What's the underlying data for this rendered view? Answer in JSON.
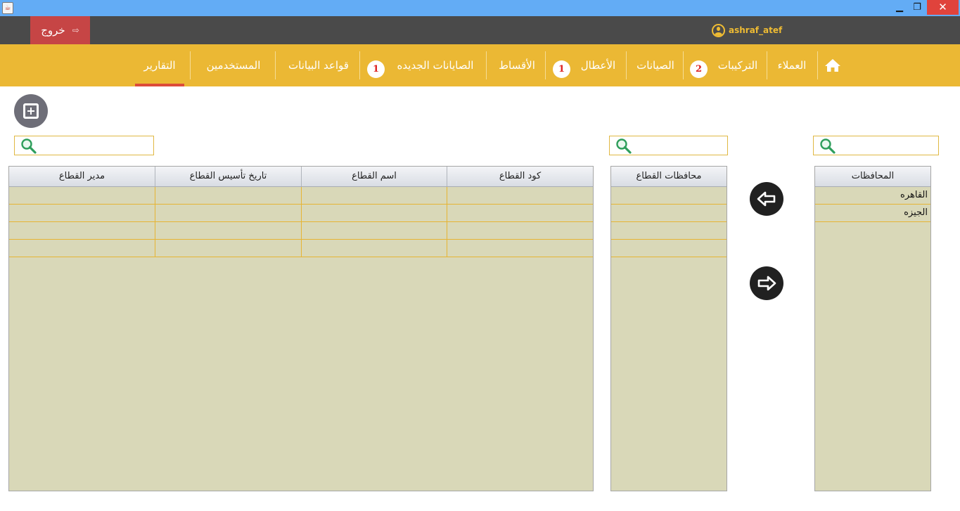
{
  "window": {
    "minimize_glyph": "▁",
    "maximize_glyph": "❐",
    "close_glyph": "✕",
    "app_icon": "java-icon"
  },
  "userbar": {
    "logout_label": "خروج",
    "logout_icon": "exit-icon",
    "username": "ashraf_atef"
  },
  "nav": {
    "home_icon": "home-icon",
    "items": [
      {
        "label": "العملاء"
      },
      {
        "label": "التركيبات",
        "badge": "2"
      },
      {
        "label": "الصيانات"
      },
      {
        "label": "الأعطال",
        "badge": "1"
      },
      {
        "label": "الأقساط"
      },
      {
        "label": "الصايانات الجديده",
        "badge": "1"
      },
      {
        "label": "قواعد البيانات"
      },
      {
        "label": "المستخدمين"
      },
      {
        "label": "التقارير",
        "active": true
      }
    ]
  },
  "colors": {
    "navbar": "#ebb834",
    "userbar": "#4a4a4a",
    "logout": "#c64545",
    "active_indicator": "#dd4b39",
    "table_bg": "#d9d8b8",
    "grid_line": "#e6b433"
  },
  "search": {
    "sectors_placeholder": "",
    "sector_governorates_placeholder": "",
    "governorates_placeholder": ""
  },
  "sectors_table": {
    "columns": [
      "كود القطاع",
      "اسم القطاع",
      "تاريخ تأسيس القطاع",
      "مدير القطاع"
    ],
    "rows": [
      [
        "",
        "",
        "",
        ""
      ],
      [
        "",
        "",
        "",
        ""
      ],
      [
        "",
        "",
        "",
        ""
      ],
      [
        "",
        "",
        "",
        ""
      ]
    ]
  },
  "sector_governorates_table": {
    "columns": [
      "محافظات القطاع"
    ],
    "rows": [
      [
        ""
      ],
      [
        ""
      ],
      [
        ""
      ],
      [
        ""
      ]
    ]
  },
  "governorates_table": {
    "columns": [
      "المحافظات"
    ],
    "rows": [
      [
        "القاهره"
      ],
      [
        "الجيزه"
      ]
    ]
  },
  "actions": {
    "add_icon": "plus-square-icon",
    "move_left_icon": "arrow-left-icon",
    "move_right_icon": "arrow-right-icon"
  }
}
